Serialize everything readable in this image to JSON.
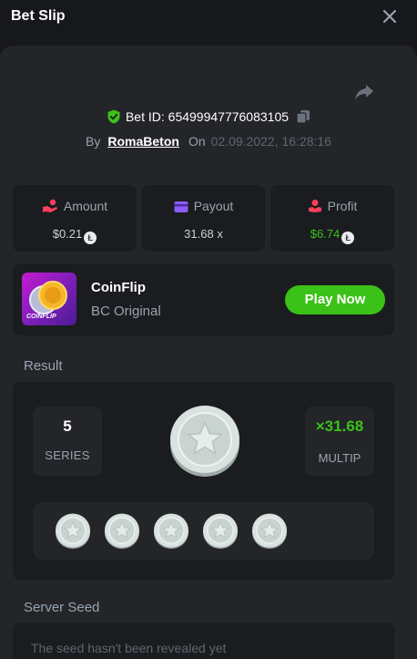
{
  "header": {
    "title": "Bet Slip"
  },
  "bet": {
    "id_text": "Bet ID: 65499947776083105",
    "by_label": "By",
    "user": "RomaBeton",
    "on_label": "On",
    "datetime": "02.09.2022, 16:28:16"
  },
  "stats": {
    "amount": {
      "label": "Amount",
      "value": "$0.21"
    },
    "payout": {
      "label": "Payout",
      "value": "31.68 x"
    },
    "profit": {
      "label": "Profit",
      "value": "$6.74"
    }
  },
  "game": {
    "name": "CoinFlip",
    "subtitle": "BC Original",
    "thumb_text": "COINFLIP",
    "play_label": "Play Now"
  },
  "result": {
    "label": "Result",
    "series_value": "5",
    "series_label": "SERIES",
    "multiplier_value": "×31.68",
    "multiplier_label": "MULTIP",
    "coin_count": 5
  },
  "server_seed": {
    "label": "Server Seed",
    "partial_text": "The seed hasn't been revealed yet"
  },
  "colors": {
    "background": "#17181b",
    "panel": "#232529",
    "card": "#1a1c1f",
    "accent_green": "#3bc117",
    "muted": "#99a4b0"
  },
  "icons": {
    "close": "close-icon",
    "share": "share-icon",
    "shield": "shield-check-icon",
    "copy": "copy-icon",
    "amount": "amount-hand-icon",
    "payout": "payout-card-icon",
    "profit": "profit-icon",
    "currency": "currency-coin-icon",
    "coin": "star-coin-icon"
  }
}
